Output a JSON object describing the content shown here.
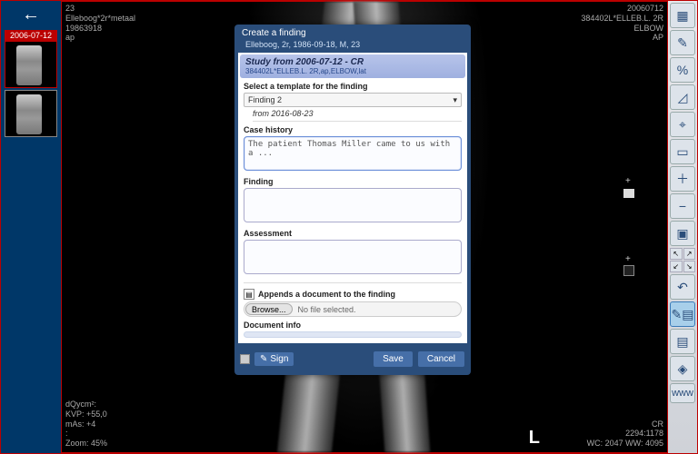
{
  "sidebar": {
    "date_label": "2006-07-12"
  },
  "overlay": {
    "tl": {
      "line1": "23",
      "line2": "Elleboog*2r*metaal",
      "line3": "19863918",
      "line4": "ap"
    },
    "tr": {
      "line1": "20060712",
      "line2": "384402L*ELLEB.L. 2R",
      "line3": "ELBOW",
      "line4": "AP"
    },
    "bl": {
      "line1": "dQycm²:",
      "line2": "KVP: +55,0",
      "line3": "mAs: +4",
      "line4": ":",
      "line5": "Zoom: 45%"
    },
    "br": {
      "line1": "CR",
      "line2": "2294:1178",
      "line3": "WC: 2047 WW: 4095"
    },
    "marker": "L"
  },
  "dialog": {
    "title": "Create a finding",
    "subtitle": "Elleboog, 2r, 1986-09-18, M, 23",
    "study_title": "Study from 2006-07-12 - CR",
    "study_sub": "384402L*ELLEB.L. 2R,ap,ELBOW,lat",
    "template_label": "Select a template for the finding",
    "template_value": "Finding 2",
    "template_from": "from 2016-08-23",
    "case_history_label": "Case history",
    "case_history_value": "The patient Thomas Miller came to us with a ...",
    "finding_label": "Finding",
    "finding_value": "",
    "assessment_label": "Assessment",
    "assessment_value": "",
    "attach_label": "Appends a document to the finding",
    "browse_label": "Browse...",
    "nofile": "No file selected.",
    "docinfo_label": "Document info",
    "sign_label": "Sign",
    "save_label": "Save",
    "cancel_label": "Cancel"
  },
  "tools": {
    "layout": "▦",
    "pencil": "✎",
    "measure": "%",
    "angle": "◿",
    "crosshair": "⌖",
    "window": "▭",
    "zoom_in": "＋",
    "zoom_out": "−",
    "fit": "▣",
    "arrows": "⤢",
    "undo": "↶",
    "findings": "✎▤",
    "save": "▤",
    "cube": "◈",
    "www": "www"
  }
}
